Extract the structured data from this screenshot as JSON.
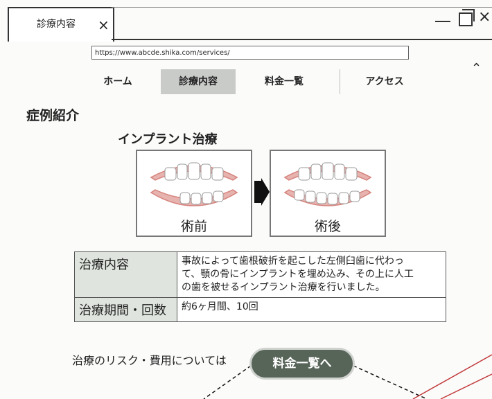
{
  "window": {
    "tab_title": "診療内容",
    "tab_close": "×",
    "close_glyph": "×",
    "scroll_up": "⌃"
  },
  "address_bar": {
    "url": "https;//www.abcde.shika.com/services/"
  },
  "nav": {
    "items": [
      {
        "label": "ホーム",
        "active": false
      },
      {
        "label": "診療内容",
        "active": true
      },
      {
        "label": "料金一覧",
        "active": false
      },
      {
        "label": "アクセス",
        "active": false
      }
    ]
  },
  "content": {
    "section_title": "症例紹介",
    "case_title": "インプラント治療",
    "before_label": "術前",
    "after_label": "術後",
    "table": {
      "rows": [
        {
          "header": "治療内容",
          "lines": [
            "事故によって歯根破折を起こした左側臼歯に代わっ",
            "て、顎の骨にインプラントを埋め込み、その上に人工",
            "の歯を被せるインプラント治療を行いました。"
          ]
        },
        {
          "header": "治療期間・回数",
          "lines": [
            "約6ヶ月間、10回"
          ]
        }
      ]
    },
    "risk_text": "治療のリスク・費用については",
    "price_button": "料金一覧へ"
  },
  "colors": {
    "nav_active": "#c9cbc9",
    "button": "#576458",
    "table_header": "#dfe5de",
    "gum": "#d6827c"
  }
}
